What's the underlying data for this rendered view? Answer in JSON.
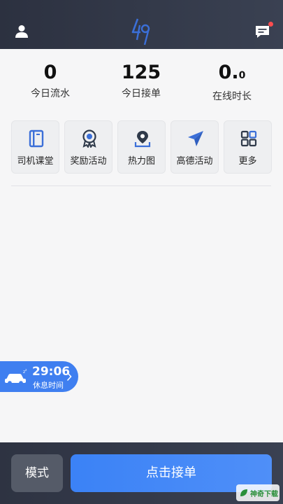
{
  "header": {
    "user_icon": "person-icon",
    "logo_icon": "49-logo-icon",
    "message_icon": "message-icon",
    "has_unread": true
  },
  "stats": [
    {
      "value": "0",
      "label": "今日流水"
    },
    {
      "value": "125",
      "label": "今日接单"
    },
    {
      "value_main": "0.",
      "value_small": "0",
      "label": "在线时长"
    }
  ],
  "tools": [
    {
      "label": "司机课堂",
      "icon": "book-icon"
    },
    {
      "label": "奖励活动",
      "icon": "award-icon"
    },
    {
      "label": "热力图",
      "icon": "map-pin-icon"
    },
    {
      "label": "高德活动",
      "icon": "paper-plane-icon"
    },
    {
      "label": "更多",
      "icon": "grid-icon"
    }
  ],
  "rest": {
    "time": "29:06",
    "label": "休息时间",
    "icon": "sleeping-car-icon"
  },
  "footer": {
    "mode_label": "模式",
    "accept_label": "点击接单"
  },
  "watermark": {
    "text": "神奇下载"
  },
  "colors": {
    "accent": "#3f7ff0",
    "header_bg": "#2c3140",
    "unread_dot": "#ff4d4f"
  }
}
